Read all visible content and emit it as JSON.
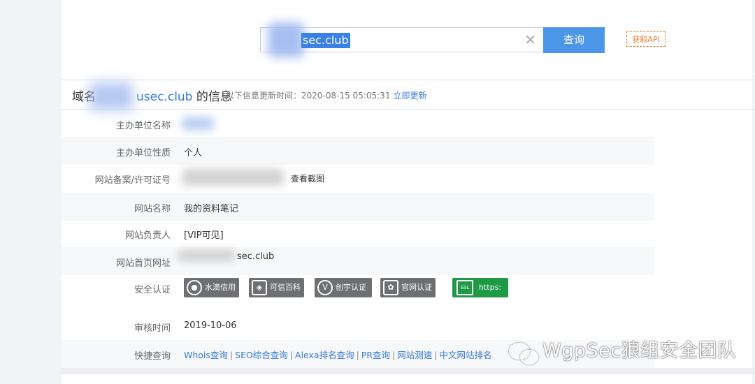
{
  "search": {
    "value": "sec.club",
    "button_label": "查询",
    "api_label": "获取API"
  },
  "header": {
    "title_prefix": "域名",
    "title_domain": "usec.club",
    "title_suffix": " 的信息",
    "update_text": "以下信息更新时间：2020-08-15 05:05:31",
    "update_link": "立即更新"
  },
  "rows": [
    {
      "label": "主办单位名称",
      "value": ""
    },
    {
      "label": "主办单位性质",
      "value": "个人"
    },
    {
      "label": "网站备案/许可证号",
      "value": "",
      "link": "查看截图"
    },
    {
      "label": "网站名称",
      "value": "我的资料笔记"
    },
    {
      "label": "网站负责人",
      "value": "[VIP可见]"
    },
    {
      "label": "网站首页网址",
      "value": "sec.club"
    },
    {
      "label": "安全认证",
      "value": ""
    },
    {
      "label": "审核时间",
      "value": "2019-10-06"
    },
    {
      "label": "快捷查询",
      "value": ""
    }
  ],
  "badges": [
    {
      "icon": "water-drop-icon",
      "label": "水滴信用"
    },
    {
      "icon": "shield-icon",
      "label": "可信百科"
    },
    {
      "icon": "v-icon",
      "label": "创宇认证"
    },
    {
      "icon": "paw-icon",
      "label": "官网认证"
    },
    {
      "icon": "ssl-icon",
      "label": "https:"
    }
  ],
  "quick_links": [
    "Whois查询",
    "SEO综合查询",
    "Alexa排名查询",
    "PR查询",
    "网站测速",
    "中文网站排名"
  ],
  "watermark": "WgpSec狼组安全团队",
  "colors": {
    "link": "#3779d9",
    "search_button": "#4b96e6",
    "api_border": "#f07c2e",
    "ssl_green": "#1e9a46"
  }
}
